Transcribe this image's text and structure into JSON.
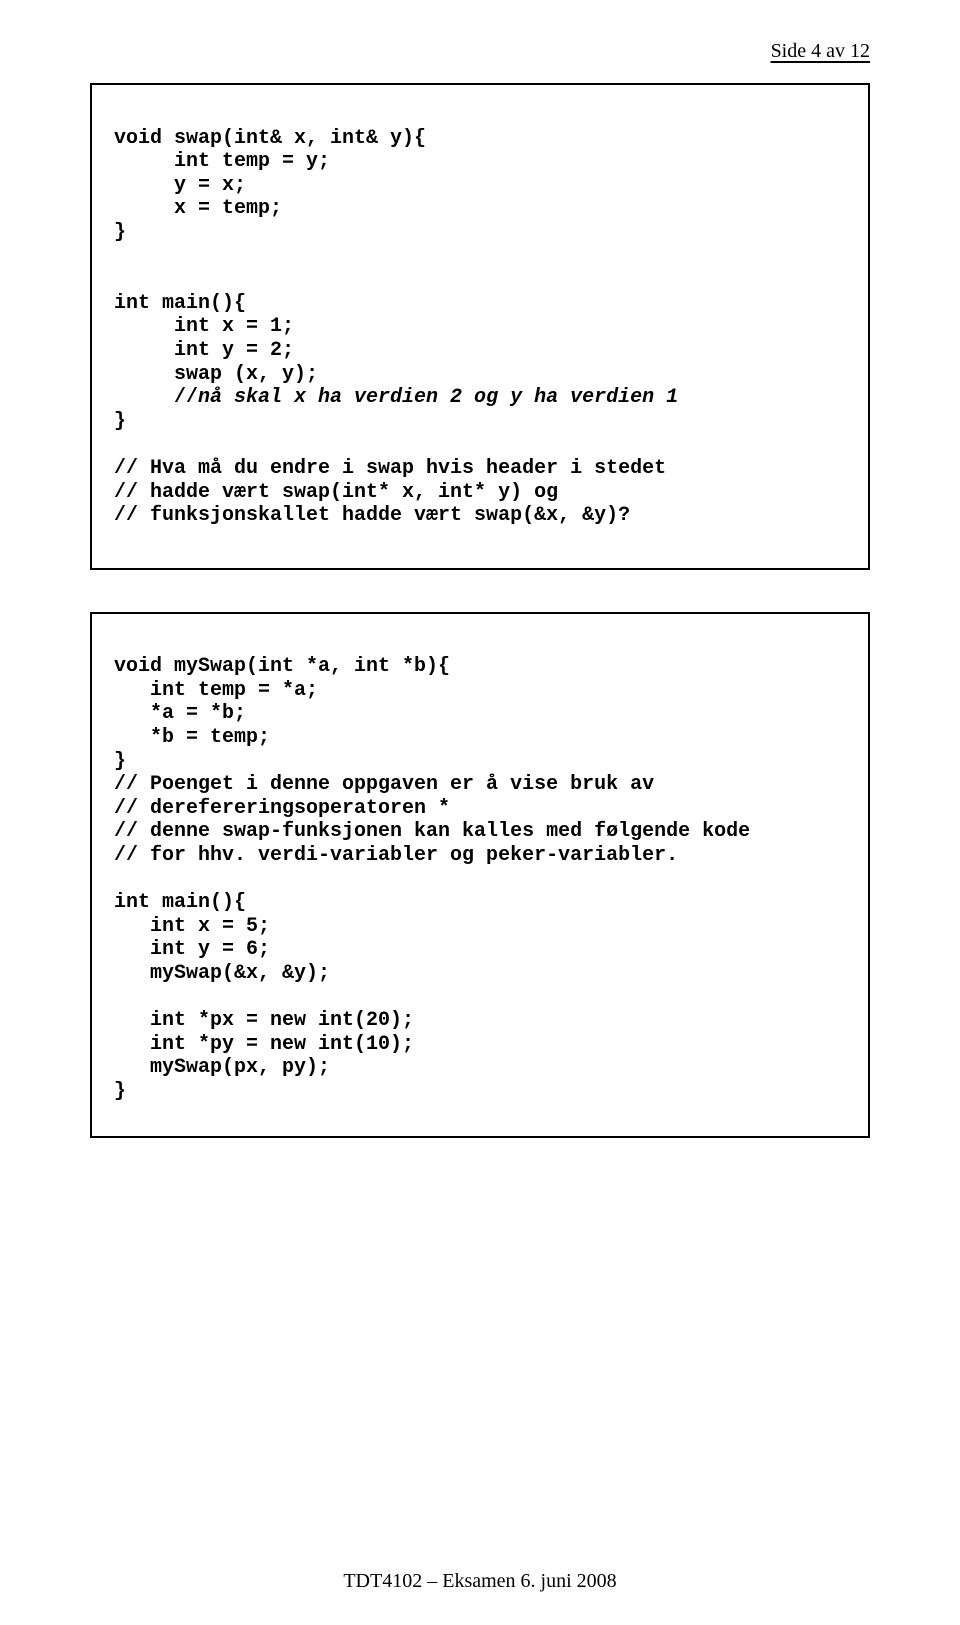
{
  "page_header": "Side 4 av 12",
  "box1": {
    "l1": "void swap(int& x, int& y){",
    "l2": "     int temp = y;",
    "l3": "     y = x;",
    "l4": "     x = temp;",
    "l5": "}",
    "l6": "",
    "l7": "",
    "l8": "int main(){",
    "l9": "     int x = 1;",
    "l10": "     int y = 2;",
    "l11": "     swap (x, y);",
    "l12_a": "     //",
    "l12_b": "nå skal x ha verdien 2 og y ha verdien 1",
    "l13": "}",
    "l14": "",
    "l15": "// Hva må du endre i swap hvis header i stedet",
    "l16": "// hadde vært swap(int* x, int* y) og",
    "l17": "// funksjonskallet hadde vært swap(&x, &y)?"
  },
  "box2": {
    "l1": "void mySwap(int *a, int *b){",
    "l2": "   int temp = *a;",
    "l3": "   *a = *b;",
    "l4": "   *b = temp;",
    "l5": "}",
    "l6": "// Poenget i denne oppgaven er å vise bruk av",
    "l7": "// derefereringsoperatoren *",
    "l8": "// denne swap-funksjonen kan kalles med følgende kode",
    "l9": "// for hhv. verdi-variabler og peker-variabler.",
    "l10": "",
    "l11": "int main(){",
    "l12": "   int x = 5;",
    "l13": "   int y = 6;",
    "l14": "   mySwap(&x, &y);",
    "l15": "",
    "l16": "   int *px = new int(20);",
    "l17": "   int *py = new int(10);",
    "l18": "   mySwap(px, py);",
    "l19": "}"
  },
  "footer": "TDT4102 – Eksamen 6. juni 2008"
}
